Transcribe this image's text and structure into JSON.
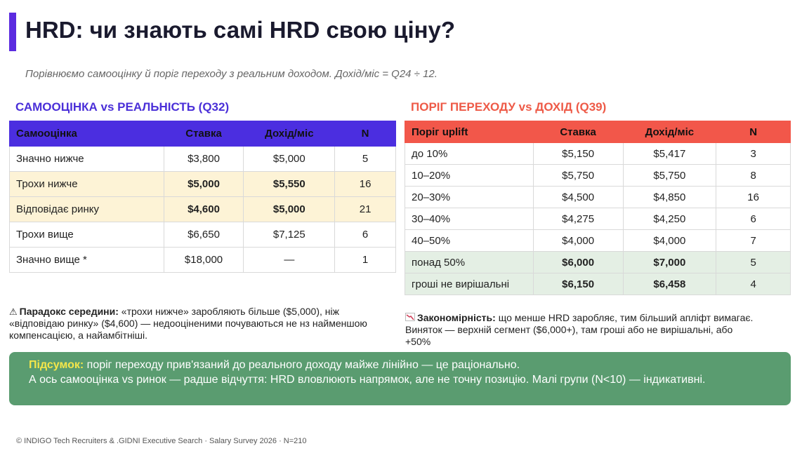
{
  "header": {
    "title": "HRD: чи знають самі HRD свою ціну?",
    "subtitle": "Порівнюємо самооцінку й поріг переходу з реальним доходом. Дохід/міс = Q24 ÷ 12."
  },
  "left_section": {
    "title": "САМООЦІНКА vs РЕАЛЬНІСТЬ (Q32)",
    "columns": [
      "Самооцінка",
      "Ставка",
      "Дохід/міс",
      "N"
    ],
    "rows": [
      [
        "Значно нижче",
        "$3,800",
        "$5,000",
        "5"
      ],
      [
        "Трохи нижче",
        "$5,000",
        "$5,550",
        "16"
      ],
      [
        "Відповідає ринку",
        "$4,600",
        "$5,000",
        "21"
      ],
      [
        "Трохи вище",
        "$6,650",
        "$7,125",
        "6"
      ],
      [
        "Значно вище *",
        "$18,000",
        "—",
        "1"
      ]
    ],
    "note_label": "Парадокс середини:",
    "note_text": " «трохи нижче» заробляють більше ($5,000), ніж «відповідаю ринку» ($4,600) — недооціненими почуваються не нз найменшою компенсацією, а найамбітніші."
  },
  "right_section": {
    "title": "ПОРІГ ПЕРЕХОДУ vs ДОХІД (Q39)",
    "columns": [
      "Поріг uplift",
      "Ставка",
      "Дохід/міс",
      "N"
    ],
    "rows": [
      [
        "до 10%",
        "$5,150",
        "$5,417",
        "3"
      ],
      [
        "10–20%",
        "$5,750",
        "$5,750",
        "8"
      ],
      [
        "20–30%",
        "$4,500",
        "$4,850",
        "16"
      ],
      [
        "30–40%",
        "$4,275",
        "$4,250",
        "6"
      ],
      [
        "40–50%",
        "$4,000",
        "$4,000",
        "7"
      ],
      [
        "понад 50%",
        "$6,000",
        "$7,000",
        "5"
      ],
      [
        "гроші не вирішальні",
        "$6,150",
        "$6,458",
        "4"
      ]
    ],
    "note_label": "Закономірність:",
    "note_text": " що менше HRD заробляє, тим більший апліфт вимагає. Виняток — верхній сегмент ($6,000+), там гроші або не вирішальні, або +50%"
  },
  "summary": {
    "label": "Підсумок:",
    "line1": " поріг переходу прив'язаний до реального доходу майже лінійно — це раціонально.",
    "line2": "А ось самооцінка vs ринок — радше відчуття: HRD вловлюють напрямок, але не точну позицію. Малі групи (N<10) — індикативні."
  },
  "footer": {
    "text": "© INDIGO Tech Recruiters & .GIDNI Executive Search · Salary Survey 2026 · N=210"
  },
  "icons": {
    "warning": "warning-icon",
    "chart": "chart-decreasing-icon"
  },
  "colors": {
    "accent_purple": "#4b2ee0",
    "accent_red": "#f2574a",
    "summary_green": "#5a9c70",
    "highlight_yellow": "#fdf3d6",
    "highlight_green": "#e4efe4"
  }
}
